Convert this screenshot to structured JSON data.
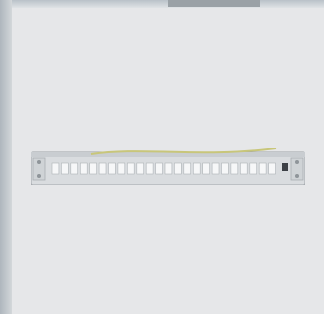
{
  "photo": {
    "subject": "patch-panel",
    "colors": {
      "background": "#e6e7e9",
      "panel_face": "#dfe1e3",
      "panel_edge": "#9ea3a8",
      "port": "#f6f7f8",
      "cable": "#c8c67a"
    },
    "port_count": 24
  }
}
